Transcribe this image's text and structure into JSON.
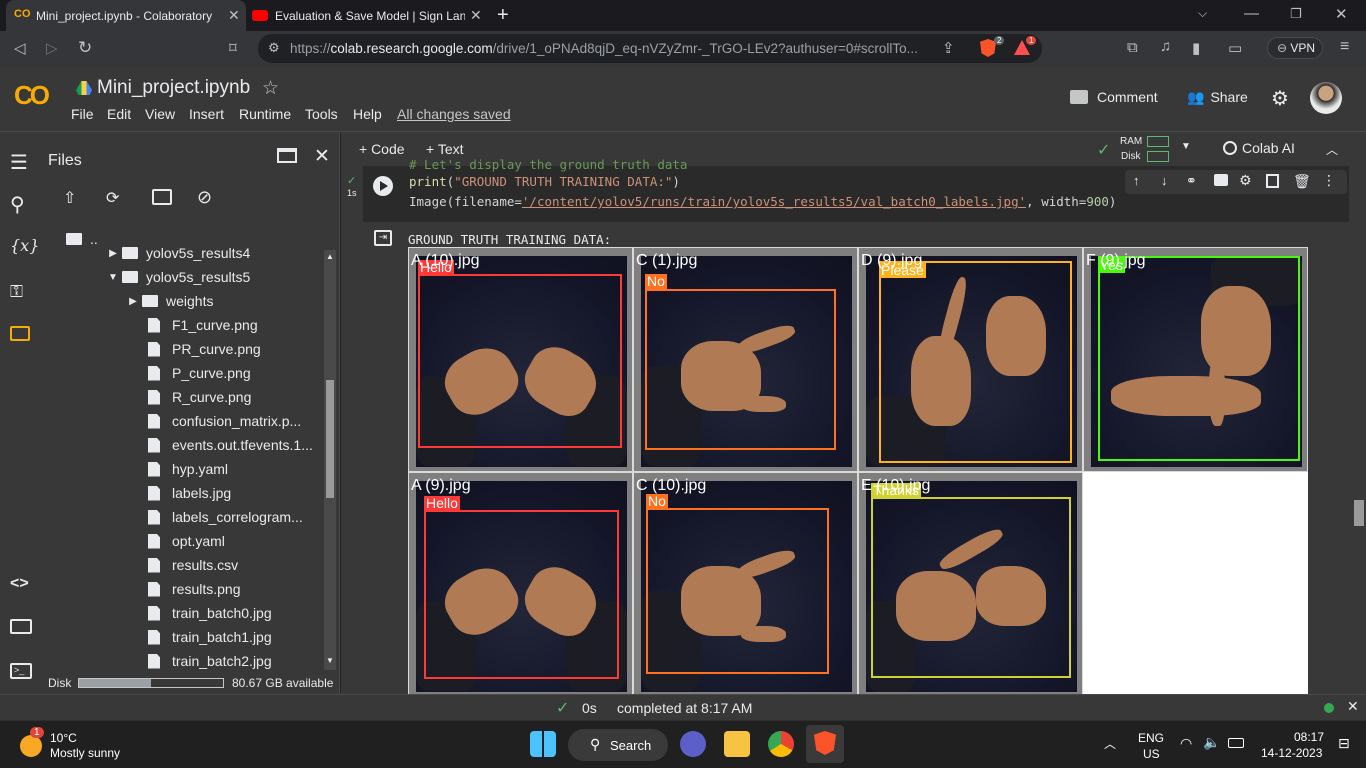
{
  "browser": {
    "tabs": [
      {
        "title": "Mini_project.ipynb - Colaboratory",
        "active": true
      },
      {
        "title": "Evaluation & Save Model | Sign Langu",
        "active": false
      }
    ],
    "url_prefix": "https://",
    "url_host": "colab.research.google.com",
    "url_path": "/drive/1_oPNAd8qjD_eq-nVZyZmr-_TrGO-LEv2?authuser=0#scrollTo...",
    "brave_badge": "2",
    "alert_badge": "1",
    "vpn_label": "VPN"
  },
  "colab": {
    "logo_text": "CO",
    "notebook_title": "Mini_project.ipynb",
    "menus": [
      "File",
      "Edit",
      "View",
      "Insert",
      "Runtime",
      "Tools",
      "Help"
    ],
    "saved_status": "All changes saved",
    "comment_label": "Comment",
    "share_label": "Share",
    "add_code_label": "+ Code",
    "add_text_label": "+ Text",
    "ram_label": "RAM",
    "disk_label": "Disk",
    "colab_ai_label": "Colab AI",
    "accent": "#f9ab00"
  },
  "sidebar": {
    "title": "Files",
    "parent_label": "..",
    "tree": [
      {
        "name": "yolov5s_results4",
        "type": "folder",
        "collapsed": true
      },
      {
        "name": "yolov5s_results5",
        "type": "folder",
        "collapsed": false
      },
      {
        "name": "weights",
        "type": "folder",
        "collapsed": true
      },
      {
        "name": "F1_curve.png",
        "type": "file"
      },
      {
        "name": "PR_curve.png",
        "type": "file"
      },
      {
        "name": "P_curve.png",
        "type": "file"
      },
      {
        "name": "R_curve.png",
        "type": "file"
      },
      {
        "name": "confusion_matrix.p...",
        "type": "file"
      },
      {
        "name": "events.out.tfevents.1...",
        "type": "file"
      },
      {
        "name": "hyp.yaml",
        "type": "file"
      },
      {
        "name": "labels.jpg",
        "type": "file"
      },
      {
        "name": "labels_correlogram...",
        "type": "file"
      },
      {
        "name": "opt.yaml",
        "type": "file"
      },
      {
        "name": "results.csv",
        "type": "file"
      },
      {
        "name": "results.png",
        "type": "file"
      },
      {
        "name": "train_batch0.jpg",
        "type": "file"
      },
      {
        "name": "train_batch1.jpg",
        "type": "file"
      },
      {
        "name": "train_batch2.jpg",
        "type": "file"
      }
    ],
    "disk_label": "Disk",
    "disk_available": "80.67 GB available",
    "disk_used_fraction": 0.5
  },
  "cell": {
    "exec_time": "1s",
    "partial_line": "# Let's display the ground truth data",
    "line1_fn": "print",
    "line1_arg": "\"GROUND TRUTH TRAINING DATA:\"",
    "line2_fn": "Image",
    "line2_kw1": "filename=",
    "line2_path": "'/content/yolov5/runs/train/yolov5s_results5/val_batch0_labels.jpg'",
    "line2_kw2": "width=",
    "line2_width": "900",
    "output_text": "GROUND TRUTH TRAINING DATA:"
  },
  "grid_tiles": [
    {
      "file": "A (10).jpg",
      "label": "Hello",
      "color": "#ff3838"
    },
    {
      "file": "C (1).jpg",
      "label": "No",
      "color": "#ff701f"
    },
    {
      "file": "D (9).jpg",
      "label": "Please",
      "color": "#ffb21d"
    },
    {
      "file": "F (9).jpg",
      "label": "Yes",
      "color": "#48f90a"
    },
    {
      "file": "A (9).jpg",
      "label": "Hello",
      "color": "#ff3838"
    },
    {
      "file": "C (10).jpg",
      "label": "No",
      "color": "#ff701f"
    },
    {
      "file": "E (10).jpg",
      "label": "Thanks",
      "color": "#cfd231"
    }
  ],
  "status": {
    "duration": "0s",
    "message": "completed at 8:17 AM"
  },
  "taskbar": {
    "weather_temp": "10°C",
    "weather_desc": "Mostly sunny",
    "weather_badge": "1",
    "search_label": "Search",
    "lang_line1": "ENG",
    "lang_line2": "US",
    "time": "08:17",
    "date": "14-12-2023"
  }
}
